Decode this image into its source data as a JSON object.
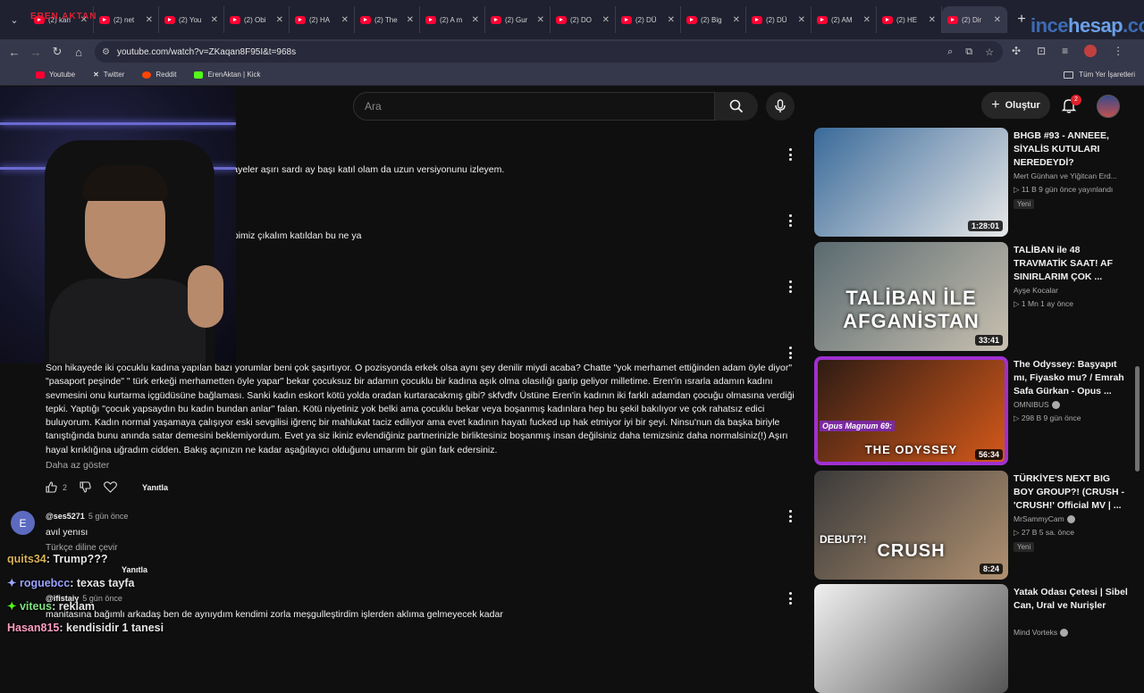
{
  "browser": {
    "tabs": [
      {
        "label": "(2) kan"
      },
      {
        "label": "(2) net"
      },
      {
        "label": "(2) You"
      },
      {
        "label": "(2) Obi"
      },
      {
        "label": "(2) HA"
      },
      {
        "label": "(2) The"
      },
      {
        "label": "(2) A m"
      },
      {
        "label": "(2) Gur"
      },
      {
        "label": "(2) DO"
      },
      {
        "label": "(2) DÜ"
      },
      {
        "label": "(2) Big"
      },
      {
        "label": "(2) DÜ"
      },
      {
        "label": "(2) AM"
      },
      {
        "label": "(2) HE"
      },
      {
        "label": "(2) Dir",
        "active": true
      }
    ],
    "url": "youtube.com/watch?v=ZKaqan8F95I&t=968s",
    "bookmarks": [
      "Youtube",
      "Twitter",
      "Reddit",
      "ErenAktan | Kick"
    ],
    "all_bookmarks": "Tüm Yer İşaretleri",
    "watermark_a": "ince",
    "watermark_b": "hesap",
    "watermark_c": ".com",
    "cam_tag": "EREN AKTAN"
  },
  "youtube": {
    "search_placeholder": "Ara",
    "create_label": "Oluştur",
    "notification_count": "2"
  },
  "comments": {
    "c1_text": "kayeler aşırı sardı ay başı katıl olam da uzun versiyonunu izleyem.",
    "c2_text": "apimiz çıkalım katıldan bu ne ya",
    "long_text": "Son hikayede iki çocuklu kadına yapılan bazı yorumlar beni çok şaşırtıyor. O pozisyonda erkek olsa aynı şey denilir miydi acaba? Chatte \"yok merhamet ettiğinden adam öyle diyor\" \"pasaport peşinde\" \" türk erkeği merhametten öyle yapar\" bekar çocuksuz bir adamın çocuklu bir kadına aşık olma olasılığı garip geliyor milletime. Eren'in ısrarla adamın kadını sevmesini onu kurtarma içgüdüsüne bağlaması. Sanki kadın eskort kötü yolda oradan kurtaracakmış gibi? skfvdfv Üstüne Eren'in kadının iki farklı adamdan çocuğu olmasına verdiği tepki. Yaptığı \"çocuk yapsaydın bu kadın bundan anlar\" falan. Kötü niyetiniz yok belki ama çocuklu bekar veya boşanmış kadınlara hep bu şekil bakılıyor ve çok rahatsız edici buluyorum. Kadın normal yaşamaya çalışıyor eski sevgilisi iğrenç bir mahlukat taciz ediliyor ama evet kadının hayatı fucked up hak etmiyor iyi bir şeyi. Ninsu'nun da başka biriyle tanıştığında bunu anında satar demesini beklemiyordum. Evet ya siz ikiniz evlendiğiniz partnerinizle birliktesiniz boşanmış insan değilsiniz daha temizsiniz daha normalsiniz(!) Aşırı hayal kırıklığına uğradım cidden. Bakış açınızın ne kadar aşağılayıcı olduğunu umarım bir gün fark edersiniz.",
    "show_less": "Daha az göster",
    "like_count": "2",
    "reply_label": "Yanıtla",
    "c3_avatar": "E",
    "c3_author": "@ses5271",
    "c3_time": "5 gün önce",
    "c3_text": "avıl yenısı",
    "translate_label": "Türkçe diline çevir",
    "c4_author": "@ifistaiy",
    "c4_time": "5 gün önce",
    "c4_text": "manitasına bağımlı arkadaş ben de aynıydım kendimi zorla meşgulleştirdim işlerden aklıma gelmeyecek kadar"
  },
  "chat": [
    {
      "name": "quits34",
      "msg": ": Trump???"
    },
    {
      "name": "roguebcc",
      "msg": ": texas tayfa"
    },
    {
      "name": "viteus",
      "msg": ": reklam"
    },
    {
      "name": "Hasan815",
      "msg": ": kendisidir 1 tanesi"
    }
  ],
  "recommendations": [
    {
      "title": "BHGB #93 - ANNEEE, SİYALİS KUTULARI NEREDEYDİ?",
      "channel": "Mert Günhan ve Yiğitcan Erd...",
      "meta": "▷ 11 B  9 gün önce yayınlandı",
      "badge": "Yeni",
      "duration": "1:28:01",
      "color_a": "#3a6a9a",
      "color_b": "#e8e8e8"
    },
    {
      "title": "TALİBAN ile 48 TRAVMATİK SAAT! AF SINIRLARIM ÇOK ...",
      "channel": "Ayşe Kocalar",
      "meta": "▷ 1 Mn  1 ay önce",
      "badge": "",
      "duration": "33:41",
      "overlay": "TALİBAN İLE AFGANİSTAN",
      "color_a": "#5a6a70",
      "color_b": "#c8c0b0"
    },
    {
      "title": "The Odyssey: Başyapıt mı, Fiyasko mu? / Emrah Safa Gürkan - Opus ...",
      "channel": "OMNIBUS",
      "meta": "▷ 298 B  9 gün önce",
      "badge": "",
      "duration": "56:34",
      "overlay": "THE ODYSSEY",
      "overlay2": "Opus Magnum 69:",
      "color_a": "#2a1a14",
      "color_b": "#d85a1a"
    },
    {
      "title": "TÜRKİYE'S NEXT BIG BOY GROUP?! (CRUSH - 'CRUSH!' Official MV | ...",
      "channel": "MrSammyCam",
      "meta": "▷ 27 B  5 sa. önce",
      "badge": "Yeni",
      "duration": "8:24",
      "overlay": "CRUSH",
      "overlay2": "DEBUT?!",
      "color_a": "#3a3a3a",
      "color_b": "#b09070"
    },
    {
      "title": "Yatak Odası Çetesi | Sibel Can, Ural ve Nurişler",
      "channel": "Mind Vorteks",
      "meta": "",
      "badge": "",
      "duration": "",
      "color_a": "#f0f0f0",
      "color_b": "#555"
    }
  ]
}
